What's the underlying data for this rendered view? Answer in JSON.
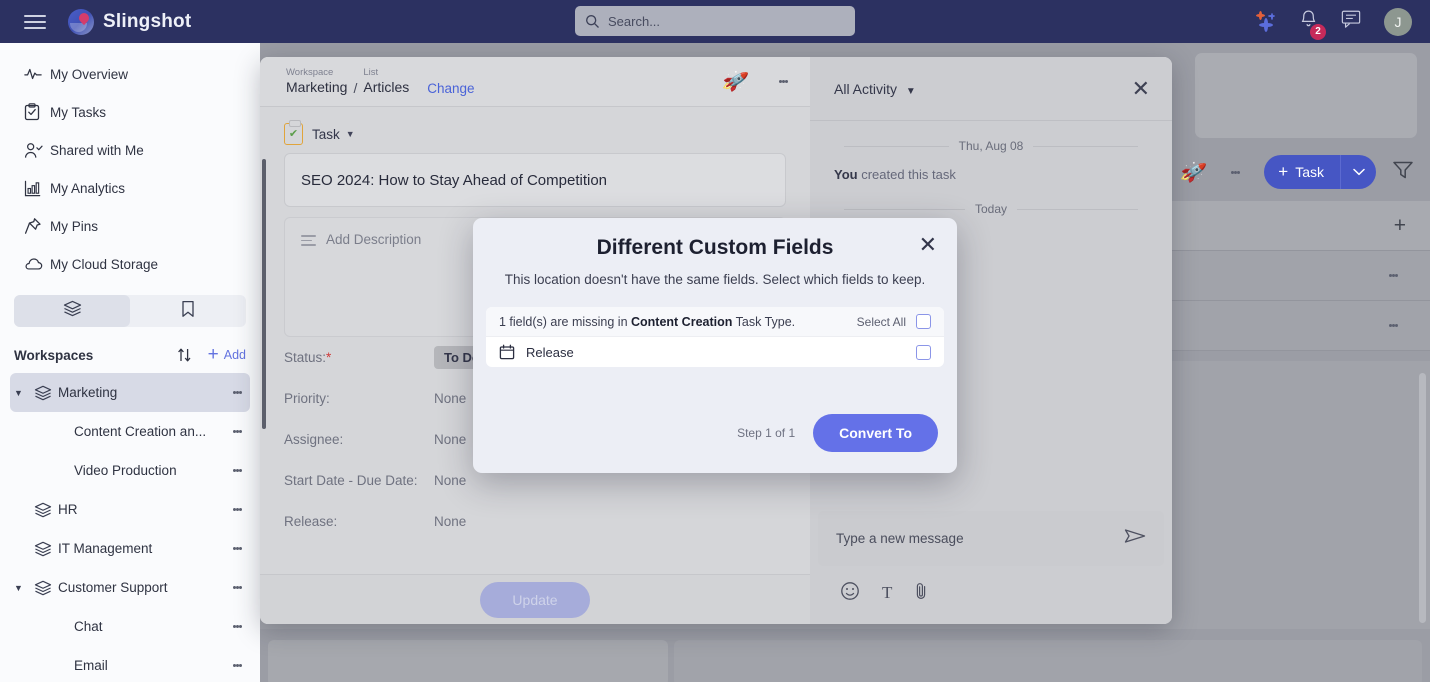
{
  "topbar": {
    "brand": "Slingshot",
    "menu_icon": "hamburger-icon",
    "search_placeholder": "Search...",
    "search_value": "",
    "notification_count": "2",
    "avatar_initial": "J"
  },
  "sidebar": {
    "nav": [
      {
        "label": "My Overview",
        "icon": "activity-pulse-icon"
      },
      {
        "label": "My Tasks",
        "icon": "clipboard-check-icon"
      },
      {
        "label": "Shared with Me",
        "icon": "user-check-icon"
      },
      {
        "label": "My Analytics",
        "icon": "bar-chart-icon"
      },
      {
        "label": "My Pins",
        "icon": "pin-icon"
      },
      {
        "label": "My Cloud Storage",
        "icon": "cloud-icon"
      }
    ],
    "tabs": [
      {
        "name": "workspaces-tab",
        "icon": "layers-icon",
        "active": true
      },
      {
        "name": "bookmarks-tab",
        "icon": "bookmark-icon",
        "active": false
      }
    ],
    "workspaces_header": {
      "title": "Workspaces",
      "sort_icon": "sort-arrows-icon",
      "add_label": "Add"
    },
    "workspaces": [
      {
        "label": "Marketing",
        "level": 0,
        "selected": true,
        "expanded": true
      },
      {
        "label": "Content Creation an...",
        "level": 1,
        "selected": false
      },
      {
        "label": "Video Production",
        "level": 1,
        "selected": false
      },
      {
        "label": "HR",
        "level": 0,
        "selected": false,
        "expanded": false
      },
      {
        "label": "IT Management",
        "level": 0,
        "selected": false,
        "expanded": false
      },
      {
        "label": "Customer Support",
        "level": 0,
        "selected": false,
        "expanded": true
      },
      {
        "label": "Chat",
        "level": 1,
        "selected": false
      },
      {
        "label": "Email",
        "level": 1,
        "selected": false
      }
    ]
  },
  "background": {
    "rocket_icon": "rocket-icon",
    "kebab_icon": "more-vertical-icon",
    "task_button_label": "Task",
    "task_button_plus": "+",
    "task_button_caret": "chevron-down-icon",
    "filter_icon": "filter-icon",
    "add_row_plus": "+"
  },
  "detail": {
    "breadcrumb": {
      "workspace_key": "Workspace",
      "workspace_value": "Marketing",
      "separator": "/",
      "list_key": "List",
      "list_value": "Articles",
      "change_label": "Change"
    },
    "rocket_icon": "rocket-icon",
    "kebab_icon": "more-vertical-icon",
    "task_type_label": "Task",
    "task_title": "SEO 2024: How to Stay Ahead of Competition",
    "description_placeholder": "Add Description",
    "fields": [
      {
        "key": "Status:",
        "required": true,
        "value": "To Do",
        "chip": true
      },
      {
        "key": "Priority:",
        "required": false,
        "value": "None",
        "chip": false
      },
      {
        "key": "Assignee:",
        "required": false,
        "value": "None",
        "chip": false
      },
      {
        "key": "Start Date - Due Date:",
        "required": false,
        "value": "None",
        "chip": false
      },
      {
        "key": "Release:",
        "required": false,
        "value": "None",
        "chip": false
      }
    ],
    "update_label": "Update"
  },
  "activity": {
    "filter_label": "All Activity",
    "close_icon": "close-icon",
    "dividers": [
      "Thu, Aug 08",
      "Today"
    ],
    "entry_actor": "You",
    "entry_text": " created this task",
    "message_placeholder": "Type a new message",
    "send_icon": "send-icon",
    "tools": [
      {
        "icon": "emoji-icon",
        "glyph": "☺"
      },
      {
        "icon": "text-format-icon",
        "glyph": "T"
      },
      {
        "icon": "attachment-icon",
        "glyph": "📎"
      }
    ]
  },
  "dialog": {
    "title": "Different Custom Fields",
    "subtitle": "This location doesn't have the same fields. Select which fields to keep.",
    "close_icon": "close-icon",
    "missing_prefix": "1 field(s) are missing in ",
    "missing_bold": "Content Creation",
    "missing_suffix": " Task Type.",
    "select_all_label": "Select All",
    "select_all_checked": false,
    "fields": [
      {
        "label": "Release",
        "icon": "calendar-icon",
        "checked": false
      }
    ],
    "step_label": "Step 1 of 1",
    "primary_button": "Convert To"
  },
  "colors": {
    "topbar": "#2c3161",
    "accent_blue": "#6471e8",
    "link_blue": "#4a63d8",
    "badge_red": "#c62a5a",
    "task_button": "#4656c4"
  }
}
